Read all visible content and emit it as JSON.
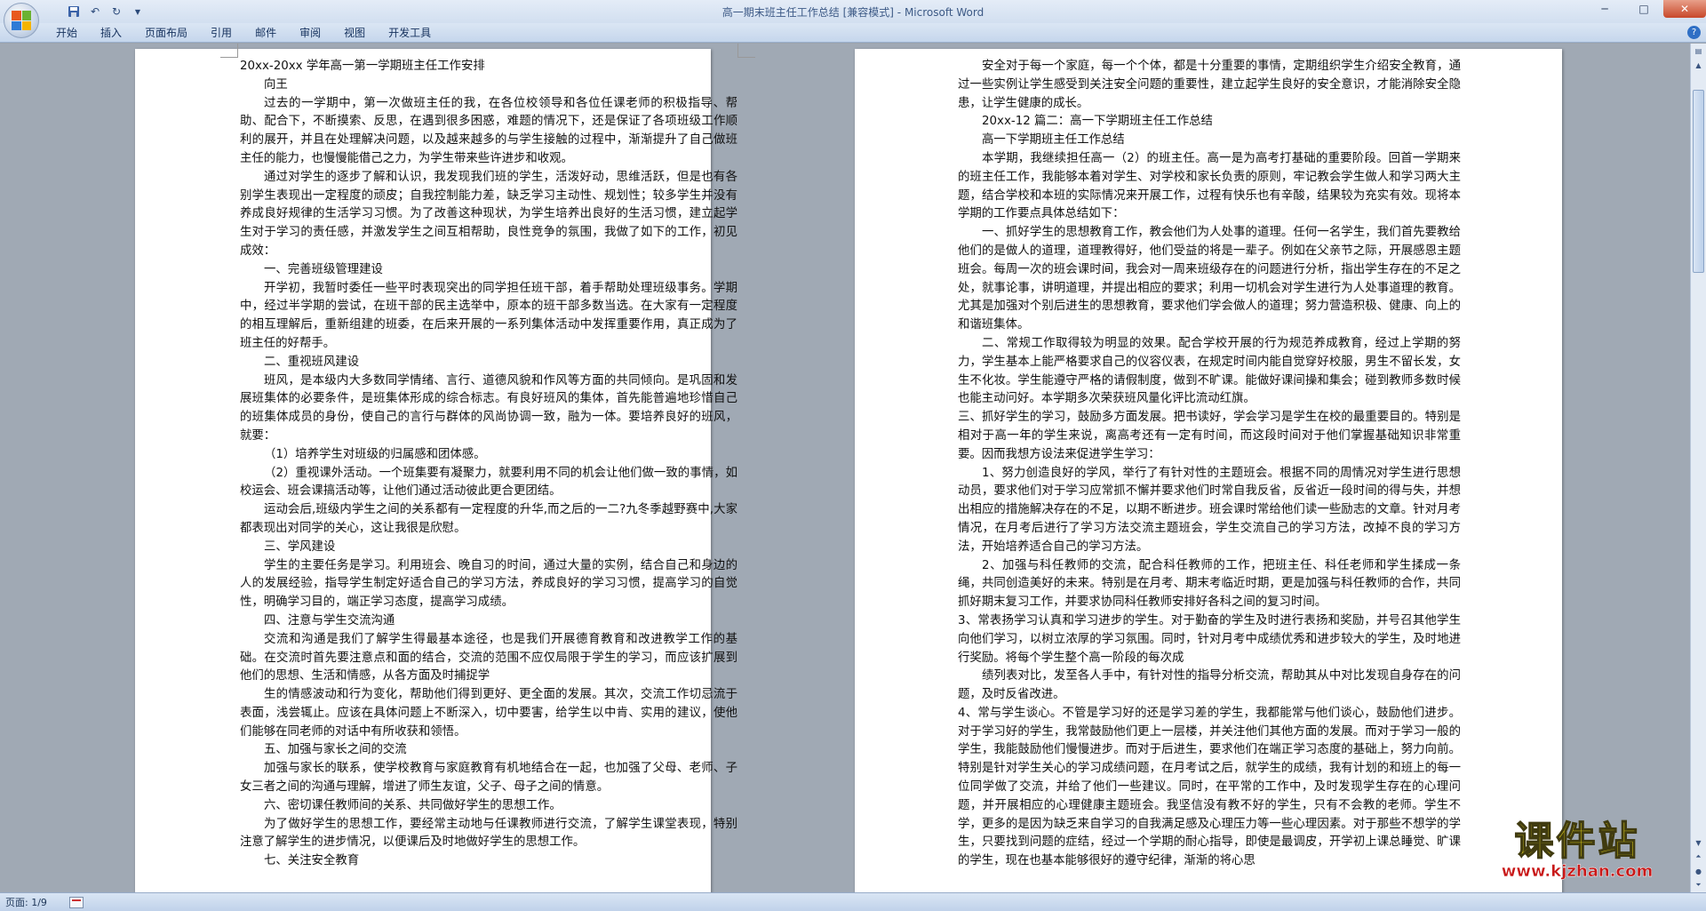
{
  "window": {
    "title_doc": "高一期末班主任工作总结 [兼容模式]",
    "title_sep": " - ",
    "title_app": "Microsoft Word",
    "minimize": "─",
    "maximize": "□",
    "close": "✕"
  },
  "quick_access": {
    "save_icon": "save-icon",
    "undo_icon": "undo-icon",
    "redo_icon": "redo-icon",
    "customize_icon": "dropdown-icon"
  },
  "ribbon": {
    "tabs": [
      "开始",
      "插入",
      "页面布局",
      "引用",
      "邮件",
      "审阅",
      "视图",
      "开发工具"
    ],
    "help": "?"
  },
  "page1": {
    "lines": [
      {
        "t": "20xx-20xx 学年高一第一学期班主任工作安排",
        "i": false
      },
      {
        "t": "向王",
        "i": true
      },
      {
        "t": "过去的一学期中，第一次做班主任的我，在各位校领导和各位任课老师的积极指导、帮助、配合下，不断摸索、反思，在遇到很多困惑，难题的情况下，还是保证了各项班级工作顺利的展开，并且在处理解决问题，以及越来越多的与学生接触的过程中，渐渐提升了自己做班主任的能力，也慢慢能借己之力，为学生带来些许进步和收观。",
        "i": true
      },
      {
        "t": "通过对学生的逐步了解和认识，我发现我们班的学生，活泼好动，思维活跃，但是也有各别学生表现出一定程度的顽皮；自我控制能力差，缺乏学习主动性、规划性；较多学生并没有养成良好规律的生活学习习惯。为了改善这种现状，为学生培养出良好的生活习惯，建立起学生对于学习的责任感，并激发学生之间互相帮助，良性竞争的氛围，我做了如下的工作，初见成效：",
        "i": true
      },
      {
        "t": "一、完善班级管理建设",
        "i": true
      },
      {
        "t": "开学初，我暂时委任一些平时表现突出的同学担任班干部，着手帮助处理班级事务。学期中，经过半学期的尝试，在班干部的民主选举中，原本的班干部多数当选。在大家有一定程度的相互理解后，重新组建的班委，在后来开展的一系列集体活动中发挥重要作用，真正成为了班主任的好帮手。",
        "i": true
      },
      {
        "t": "二、重视班风建设",
        "i": true
      },
      {
        "t": "班风，是本级内大多数同学情绪、言行、道德风貌和作风等方面的共同倾向。是巩固和发展班集体的必要条件，是班集体形成的综合标志。有良好班风的集体，首先能普遍地珍惜自己的班集体成员的身份，使自己的言行与群体的风尚协调一致，融为一体。要培养良好的班风，就要：",
        "i": true
      },
      {
        "t": "（1）培养学生对班级的归属感和团体感。",
        "i": true
      },
      {
        "t": "（2）重视课外活动。一个班集要有凝聚力，就要利用不同的机会让他们做一致的事情，如校运会、班会课搞活动等，让他们通过活动彼此更合更团结。",
        "i": true
      },
      {
        "t": "运动会后,班级内学生之间的关系都有一定程度的升华,而之后的一二?九冬季越野赛中,大家都表现出对同学的关心，这让我很是欣慰。",
        "i": true
      },
      {
        "t": "三、学风建设",
        "i": true
      },
      {
        "t": "学生的主要任务是学习。利用班会、晚自习的时间，通过大量的实例，结合自己和身边的人的发展经验，指导学生制定好适合自己的学习方法，养成良好的学习习惯，提高学习的自觉性，明确学习目的，端正学习态度，提高学习成绩。",
        "i": true
      },
      {
        "t": "四、注意与学生交流沟通",
        "i": true
      },
      {
        "t": "交流和沟通是我们了解学生得最基本途径，也是我们开展德育教育和改进教学工作的基础。在交流时首先要注意点和面的结合，交流的范围不应仅局限于学生的学习，而应该扩展到他们的思想、生活和情感，从各方面及时捕捉学",
        "i": true
      },
      {
        "t": "生的情感波动和行为变化，帮助他们得到更好、更全面的发展。其次，交流工作切忌流于表面，浅尝辄止。应该在具体问题上不断深入，切中要害，给学生以中肯、实用的建议，使他们能够在同老师的对话中有所收获和领悟。",
        "i": true
      },
      {
        "t": "五、加强与家长之间的交流",
        "i": true
      },
      {
        "t": "加强与家长的联系，使学校教育与家庭教育有机地结合在一起，也加强了父母、老师、子女三者之间的沟通与理解，增进了师生友谊，父子、母子之间的情意。",
        "i": true
      },
      {
        "t": "六、密切课任教师间的关系、共同做好学生的思想工作。",
        "i": true
      },
      {
        "t": "为了做好学生的思想工作，要经常主动地与任课教师进行交流，了解学生课堂表现，特别注意了解学生的进步情况，以便课后及时地做好学生的思想工作。",
        "i": true
      },
      {
        "t": "七、关注安全教育",
        "i": true
      }
    ]
  },
  "page2": {
    "lines": [
      {
        "t": "安全对于每一个家庭，每一个个体，都是十分重要的事情，定期组织学生介绍安全教育，通过一些实例让学生感受到关注安全问题的重要性，建立起学生良好的安全意识，才能消除安全隐患，让学生健康的成长。",
        "i": true
      },
      {
        "t": "20xx-12 篇二：高一下学期班主任工作总结",
        "i": true
      },
      {
        "t": "高一下学期班主任工作总结",
        "i": true
      },
      {
        "t": "本学期，我继续担任高一（2）的班主任。高一是为高考打基础的重要阶段。回首一学期来的班主任工作，我能够本着对学生、对学校和家长负责的原则，牢记教会学生做人和学习两大主题，结合学校和本班的实际情况来开展工作，过程有快乐也有辛酸，结果较为充实有效。现将本学期的工作要点具体总结如下：",
        "i": true
      },
      {
        "t": "一、抓好学生的思想教育工作，教会他们为人处事的道理。任何一名学生，我们首先要教给他们的是做人的道理，道理教得好，他们受益的将是一辈子。例如在父亲节之际，开展感恩主题班会。每周一次的班会课时间，我会对一周来班级存在的问题进行分析，指出学生存在的不足之处，就事论事，讲明道理，并提出相应的要求；利用一切机会对学生进行为人处事道理的教育。尤其是加强对个别后进生的思想教育，要求他们学会做人的道理；努力营造积极、健康、向上的和谐班集体。",
        "i": true
      },
      {
        "t": "二、常规工作取得较为明显的效果。配合学校开展的行为规范养成教育，经过上学期的努力，学生基本上能严格要求自己的仪容仪表，在规定时间内能自觉穿好校服，男生不留长发，女生不化妆。学生能遵守严格的请假制度，做到不旷课。能做好课间操和集会；碰到教师多数时候也能主动问好。本学期多次荣获班风量化评比流动红旗。",
        "i": true
      },
      {
        "t": "三、抓好学生的学习，鼓励多方面发展。把书读好，学会学习是学生在校的最重要目的。特别是相对于高一年的学生来说，离高考还有一定有时间，而这段时间对于他们掌握基础知识非常重要。因而我想方设法来促进学生学习：",
        "i": false
      },
      {
        "t": "1、努力创造良好的学风，举行了有针对性的主题班会。根据不同的周情况对学生进行思想动员，要求他们对于学习应常抓不懈并要求他们时常自我反省，反省近一段时间的得与失，并想出相应的措施解决存在的不足，以期不断进步。班会课时常给他们读一些励志的文章。针对月考情况，在月考后进行了学习方法交流主题班会，学生交流自己的学习方法，改掉不良的学习方法，开始培养适合自己的学习方法。",
        "i": true
      },
      {
        "t": "2、加强与科任教师的交流，配合科任教师的工作，把班主任、科任老师和学生揉成一条绳，共同创造美好的未来。特别是在月考、期末考临近时期，更是加强与科任教师的合作，共同抓好期末复习工作，并要求协同科任教师安排好各科之间的复习时间。",
        "i": true
      },
      {
        "t": "3、常表扬学习认真和学习进步的学生。对于勤奋的学生及时进行表扬和奖励，并号召其他学生向他们学习，以树立浓厚的学习氛围。同时，针对月考中成绩优秀和进步较大的学生，及时地进行奖励。将每个学生整个高一阶段的每次成",
        "i": false
      },
      {
        "t": "绩列表对比，发至各人手中，有针对性的指导分析交流，帮助其从中对比发现自身存在的问题，及时反省改进。",
        "i": true
      },
      {
        "t": "4、常与学生谈心。不管是学习好的还是学习差的学生，我都能常与他们谈心，鼓励他们进步。对于学习好的学生，我常鼓励他们更上一层楼，并关注他们其他方面的发展。而对于学习一般的学生，我能鼓励他们慢慢进步。而对于后进生，要求他们在端正学习态度的基础上，努力向前。特别是针对学生关心的学习成绩问题，在月考试之后，就学生的成绩，我有计划的和班上的每一位同学做了交流，并给了他们一些建议。同时，在平常的工作中，及时发现学生存在的心理问题，并开展相应的心理健康主题班会。我坚信没有教不好的学生，只有不会教的老师。学生不学，更多的是因为缺乏来自学习的自我满足感及心理压力等一些心理因素。对于那些不想学的学生，只要找到问题的症结，经过一个学期的耐心指导，即使是最调皮，开学初上课总睡觉、旷课的学生，现在也基本能够很好的遵守纪律，渐渐的将心思",
        "i": false
      }
    ]
  },
  "status": {
    "page_indicator": "页面: 1/9"
  },
  "watermark": {
    "title": "课件站",
    "url": "www.kjzhan.com"
  },
  "colors": {
    "ribbon_text": "#15315d",
    "title_text": "#3d5a86",
    "watermark_yellow": "#f5e21a",
    "watermark_red": "#c81818"
  }
}
